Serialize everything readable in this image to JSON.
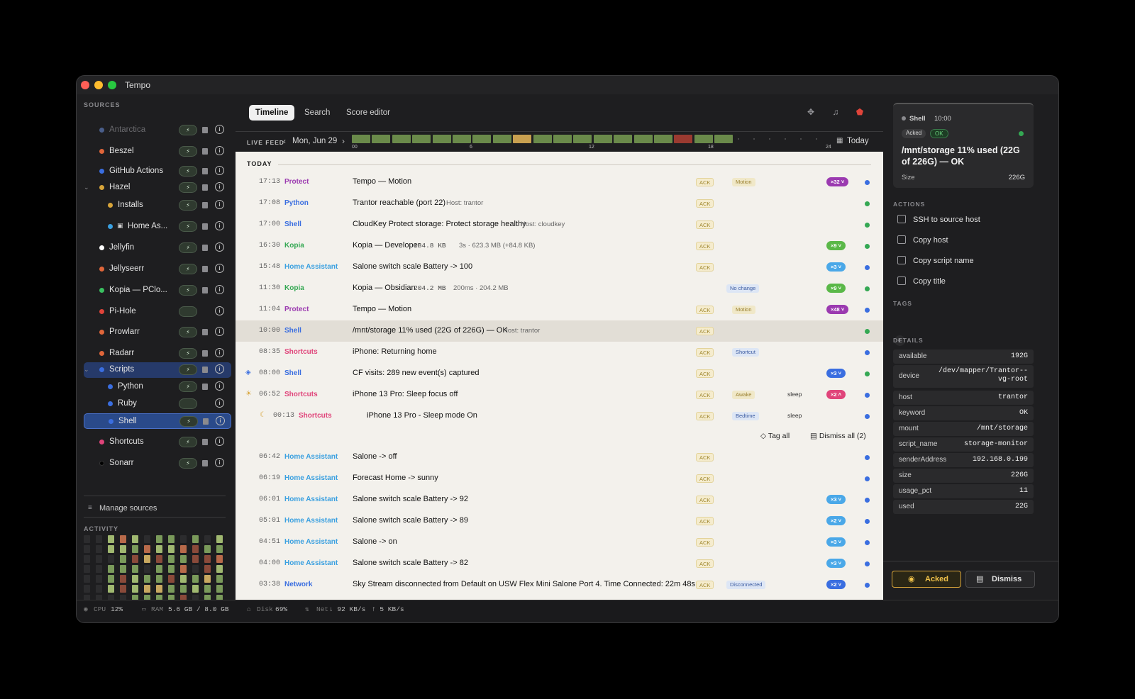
{
  "app": {
    "title": "Tempo"
  },
  "sidebar": {
    "sources_heading": "SOURCES",
    "sources": [
      {
        "name": "Antarctica",
        "color": "#4a5e8a",
        "dim": true
      },
      {
        "name": "Beszel",
        "color": "#e0663a"
      },
      {
        "name": "GitHub Actions",
        "color": "#3a6ee0"
      },
      {
        "name": "Hazel",
        "color": "#d8a53a"
      },
      {
        "name": "Installs",
        "color": "#d8a53a"
      },
      {
        "name": "Home As...",
        "color": "#3aa0e0"
      },
      {
        "name": "Jellyfin",
        "color": "#ffffff"
      },
      {
        "name": "Jellyseerr",
        "color": "#e0663a"
      },
      {
        "name": "Kopia — PClo...",
        "color": "#3ac060"
      },
      {
        "name": "Pi-Hole",
        "color": "#e0443a"
      },
      {
        "name": "Prowlarr",
        "color": "#e0663a"
      },
      {
        "name": "Radarr",
        "color": "#e0663a"
      },
      {
        "name": "Scripts",
        "color": "#3a6ee0"
      },
      {
        "name": "Python",
        "color": "#3a6ee0"
      },
      {
        "name": "Ruby",
        "color": "#3a6ee0"
      },
      {
        "name": "Shell",
        "color": "#3a6ee0"
      },
      {
        "name": "Shortcuts",
        "color": "#e0447a"
      },
      {
        "name": "Sonarr",
        "color": "#000000"
      }
    ],
    "manage": "Manage sources",
    "activity_heading": "ACTIVITY"
  },
  "statusbar": {
    "cpu_label": "CPU",
    "cpu": "12%",
    "ram_label": "RAM",
    "ram": "5.6 GB / 8.0 GB",
    "disk_label": "Disk",
    "disk": "69%",
    "net_label": "Net",
    "down": "↓ 92 KB/s",
    "up": "↑ 5 KB/s"
  },
  "toolbar": {
    "tabs": [
      "Timeline",
      "Search",
      "Score editor"
    ]
  },
  "livefeed": {
    "label": "LIVE FEED",
    "date": "Mon, Jun 29",
    "today": "Today",
    "ticks": [
      "00",
      "6",
      "12",
      "18",
      "24"
    ]
  },
  "timeline": {
    "day": "TODAY",
    "ack": "ACK",
    "rows": [
      {
        "time": "17:13",
        "source": "Protect",
        "title": "Tempo — Motion",
        "tag": "Motion",
        "count": "×32"
      },
      {
        "time": "17:08",
        "source": "Python",
        "title": "Trantor reachable (port 22)",
        "host": "Host: trantor"
      },
      {
        "time": "17:00",
        "source": "Shell",
        "title": "CloudKey Protect storage: Protect storage healthy",
        "host": "Host: cloudkey"
      },
      {
        "time": "16:30",
        "source": "Kopia",
        "title": "Kopia — Developer",
        "mono": "+84.8 KB",
        "host": "3s · 623.3 MB (+84.8 KB)",
        "count": "×9"
      },
      {
        "time": "15:48",
        "source": "Home Assistant",
        "title": "Salone switch scale Battery -> 100",
        "count": "×3"
      },
      {
        "time": "11:30",
        "source": "Kopia",
        "title": "Kopia — Obsidian",
        "mono": "204.2 MB",
        "host": "200ms · 204.2 MB",
        "tag": "No change",
        "count": "×9"
      },
      {
        "time": "11:04",
        "source": "Protect",
        "title": "Tempo — Motion",
        "tag": "Motion",
        "count": "×48"
      },
      {
        "time": "10:00",
        "source": "Shell",
        "title": "/mnt/storage 11% used (22G of 226G) — OK",
        "host": "Host: trantor"
      },
      {
        "time": "08:35",
        "source": "Shortcuts",
        "title": "iPhone: Returning home",
        "tag": "Shortcut"
      },
      {
        "time": "08:00",
        "source": "Shell",
        "title": "CF visits: 289 new event(s) captured",
        "count": "×3"
      },
      {
        "time": "06:52",
        "source": "Shortcuts",
        "title": "iPhone 13 Pro: Sleep focus off",
        "tag": "Awake",
        "extra": "sleep",
        "count": "×2"
      },
      {
        "time": "00:13",
        "source": "Shortcuts",
        "title": "iPhone 13 Pro - Sleep mode On",
        "tag": "Bedtime",
        "extra": "sleep"
      },
      {
        "time": "06:42",
        "source": "Home Assistant",
        "title": "Salone -> off"
      },
      {
        "time": "06:19",
        "source": "Home Assistant",
        "title": "Forecast Home -> sunny"
      },
      {
        "time": "06:01",
        "source": "Home Assistant",
        "title": "Salone switch scale Battery -> 92",
        "count": "×3"
      },
      {
        "time": "05:01",
        "source": "Home Assistant",
        "title": "Salone switch scale Battery -> 89",
        "count": "×2"
      },
      {
        "time": "04:51",
        "source": "Home Assistant",
        "title": "Salone -> on",
        "count": "×3"
      },
      {
        "time": "04:00",
        "source": "Home Assistant",
        "title": "Salone switch scale Battery -> 82",
        "count": "×3"
      },
      {
        "time": "03:38",
        "source": "Network",
        "title": "Sky Stream disconnected from Default on USW Flex Mini Salone Port 4. Time Connected: 22m 48s....",
        "tag": "Disconnected",
        "count": "×2"
      }
    ],
    "group_actions": {
      "tag_all": "Tag all",
      "dismiss_all": "Dismiss all (2)"
    }
  },
  "detail": {
    "source": "Shell",
    "time": "10:00",
    "status1": "Acked",
    "status2": "OK",
    "title": "/mnt/storage 11% used (22G of 226G) — OK",
    "size_label": "Size",
    "size_value": "226G",
    "actions_heading": "ACTIONS",
    "actions": [
      "SSH to source host",
      "Copy host",
      "Copy script name",
      "Copy title"
    ],
    "tags_heading": "TAGS",
    "details_heading": "DETAILS",
    "details": [
      {
        "k": "available",
        "v": "192G"
      },
      {
        "k": "device",
        "v": "/dev/mapper/Trantor--vg-root"
      },
      {
        "k": "host",
        "v": "trantor"
      },
      {
        "k": "keyword",
        "v": "OK"
      },
      {
        "k": "mount",
        "v": "/mnt/storage"
      },
      {
        "k": "script_name",
        "v": "storage-monitor"
      },
      {
        "k": "senderAddress",
        "v": "192.168.0.199"
      },
      {
        "k": "size",
        "v": "226G"
      },
      {
        "k": "usage_pct",
        "v": "11"
      },
      {
        "k": "used",
        "v": "22G"
      }
    ],
    "acked_btn": "Acked",
    "dismiss_btn": "Dismiss"
  },
  "colors": {
    "protect": "#9b3ab0",
    "python": "#3a6ee0",
    "shell": "#3a6ee0",
    "kopia": "#34a853",
    "home_assistant": "#3aa0e0",
    "shortcuts": "#e0447a",
    "network": "#3a6ee0"
  }
}
